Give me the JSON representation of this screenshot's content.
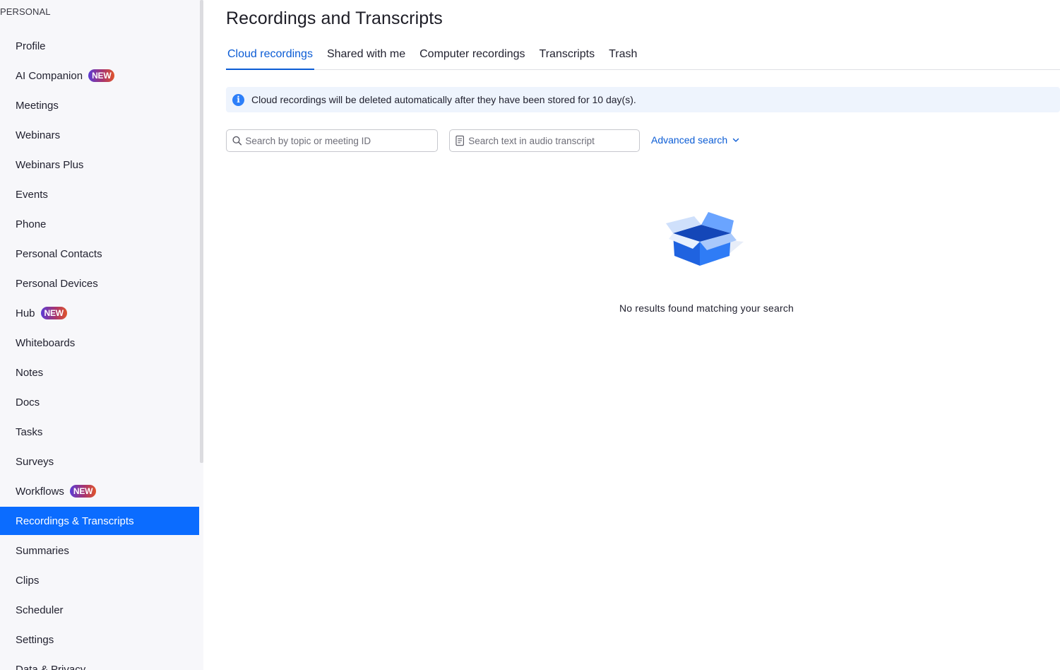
{
  "sidebar": {
    "section_title": "PERSONAL",
    "badge_label": "NEW",
    "items": [
      {
        "label": "Profile"
      },
      {
        "label": "AI Companion",
        "badge": "NEW"
      },
      {
        "label": "Meetings"
      },
      {
        "label": "Webinars"
      },
      {
        "label": "Webinars Plus"
      },
      {
        "label": "Events"
      },
      {
        "label": "Phone"
      },
      {
        "label": "Personal Contacts"
      },
      {
        "label": "Personal Devices"
      },
      {
        "label": "Hub",
        "badge": "NEW"
      },
      {
        "label": "Whiteboards"
      },
      {
        "label": "Notes"
      },
      {
        "label": "Docs"
      },
      {
        "label": "Tasks"
      },
      {
        "label": "Surveys"
      },
      {
        "label": "Workflows",
        "badge": "NEW"
      },
      {
        "label": "Recordings & Transcripts",
        "active": true
      },
      {
        "label": "Summaries"
      },
      {
        "label": "Clips"
      },
      {
        "label": "Scheduler"
      },
      {
        "label": "Settings"
      },
      {
        "label": "Data & Privacy"
      }
    ]
  },
  "main": {
    "title": "Recordings and Transcripts",
    "tabs": [
      {
        "label": "Cloud recordings",
        "active": true
      },
      {
        "label": "Shared with me"
      },
      {
        "label": "Computer recordings"
      },
      {
        "label": "Transcripts"
      },
      {
        "label": "Trash"
      }
    ],
    "info_banner": "Cloud recordings will be deleted automatically after they have been stored for 10 day(s).",
    "search_topic": {
      "placeholder": "Search by topic or meeting ID",
      "value": ""
    },
    "search_transcript": {
      "placeholder": "Search text in audio transcript",
      "value": ""
    },
    "advanced_search_label": "Advanced search",
    "empty_message": "No results found matching your search"
  },
  "colors": {
    "accent": "#0b6cff",
    "link": "#0b5cd5",
    "sidebar_bg": "#f7f7fa",
    "banner_bg": "#eef4fd"
  },
  "icons": {
    "info": "info-icon",
    "search": "search-icon",
    "transcript": "transcript-icon",
    "chevron": "chevron-down-icon",
    "empty": "empty-box-icon"
  }
}
